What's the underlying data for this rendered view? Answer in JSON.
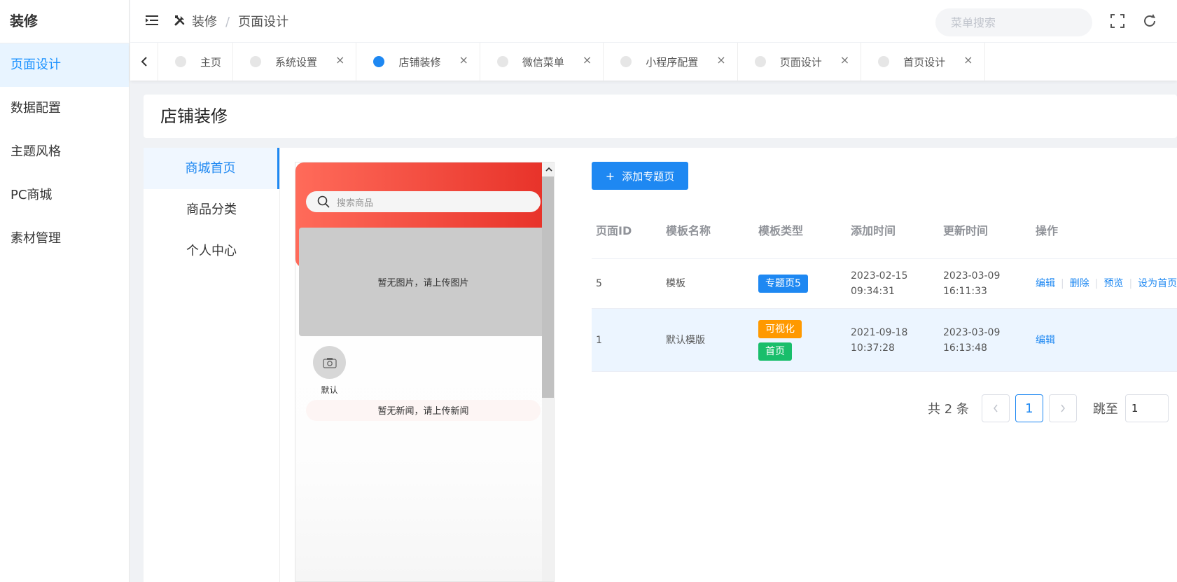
{
  "sidebar": {
    "title": "装修",
    "items": [
      {
        "label": "页面设计"
      },
      {
        "label": "数据配置"
      },
      {
        "label": "主题风格"
      },
      {
        "label": "PC商城"
      },
      {
        "label": "素材管理"
      }
    ]
  },
  "header": {
    "breadcrumb": [
      "装修",
      "页面设计"
    ],
    "search_placeholder": "菜单搜索",
    "separator": "/"
  },
  "tabs": [
    {
      "label": "主页"
    },
    {
      "label": "系统设置",
      "close": "×"
    },
    {
      "label": "店铺装修",
      "close": "×"
    },
    {
      "label": "微信菜单",
      "close": "×"
    },
    {
      "label": "小程序配置",
      "close": "×"
    },
    {
      "label": "页面设计",
      "close": "×"
    },
    {
      "label": "首页设计",
      "close": "×"
    }
  ],
  "page_title": "店铺装修",
  "left_nav": [
    {
      "label": "商城首页"
    },
    {
      "label": "商品分类"
    },
    {
      "label": "个人中心"
    }
  ],
  "phone": {
    "search_placeholder": "搜索商品",
    "banner_text": "暂无图片，请上传图片",
    "category_label": "默认",
    "news_text": "暂无新闻，请上传新闻"
  },
  "toolbar": {
    "add_label": "添加专题页",
    "add_icon": "+"
  },
  "table": {
    "headers": [
      "页面ID",
      "模板名称",
      "模板类型",
      "添加时间",
      "更新时间",
      "操作"
    ],
    "rows": [
      {
        "id": "5",
        "name": "模板",
        "tags": [
          "专题页5"
        ],
        "added": "2023-02-15 09:34:31",
        "updated": "2023-03-09 16:11:33",
        "actions": [
          "编辑",
          "删除",
          "预览",
          "设为首页"
        ]
      },
      {
        "id": "1",
        "name": "默认模版",
        "tags": [
          "可视化",
          "首页"
        ],
        "added": "2021-09-18 10:37:28",
        "updated": "2023-03-09 16:13:48",
        "actions": [
          "编辑"
        ]
      }
    ]
  },
  "pagination": {
    "total_text": "共 2 条",
    "current_page": "1",
    "jump_label": "跳至",
    "jump_value": "1"
  },
  "colors": {
    "accent": "#1e88f2",
    "tag_orange": "#ff9900",
    "tag_green": "#19be6b",
    "phone_header_start": "#ff6b5a",
    "phone_header_end": "#e8332a"
  }
}
